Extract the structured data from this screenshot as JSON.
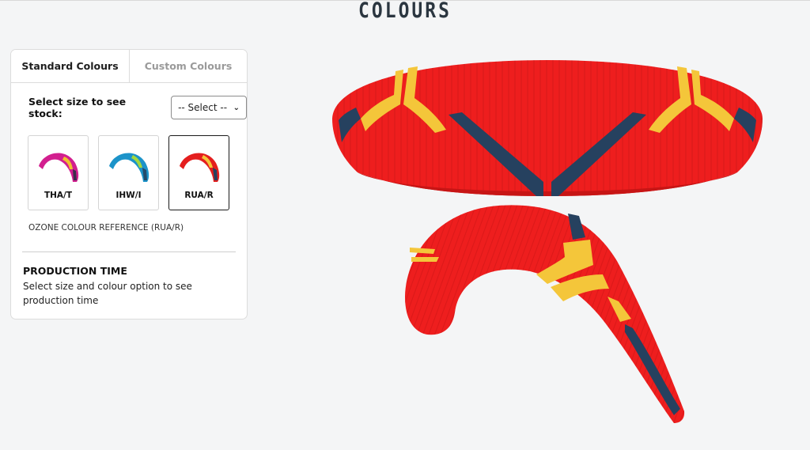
{
  "page": {
    "title": "COLOURS"
  },
  "tabs": [
    {
      "label": "Standard Colours",
      "active": true
    },
    {
      "label": "Custom Colours",
      "active": false
    }
  ],
  "stock": {
    "label": "Select size to see stock:",
    "select_value": "-- Select --"
  },
  "swatches": [
    {
      "code": "THA/T",
      "colors": [
        "#d21f8f",
        "#f0c02f",
        "#3a2d4a"
      ],
      "selected": false
    },
    {
      "code": "IHW/I",
      "colors": [
        "#1c93c9",
        "#a6d83d",
        "#234a6a"
      ],
      "selected": false
    },
    {
      "code": "RUA/R",
      "colors": [
        "#e41e1e",
        "#f4c63a",
        "#26415f"
      ],
      "selected": true
    }
  ],
  "colour_reference": "OZONE COLOUR REFERENCE (RUA/R)",
  "production": {
    "title": "PRODUCTION TIME",
    "text": "Select size and colour option to see production time"
  },
  "colors": {
    "wing_red": "#ee1e1e",
    "wing_yellow": "#f4c63a",
    "wing_navy": "#26415f"
  }
}
